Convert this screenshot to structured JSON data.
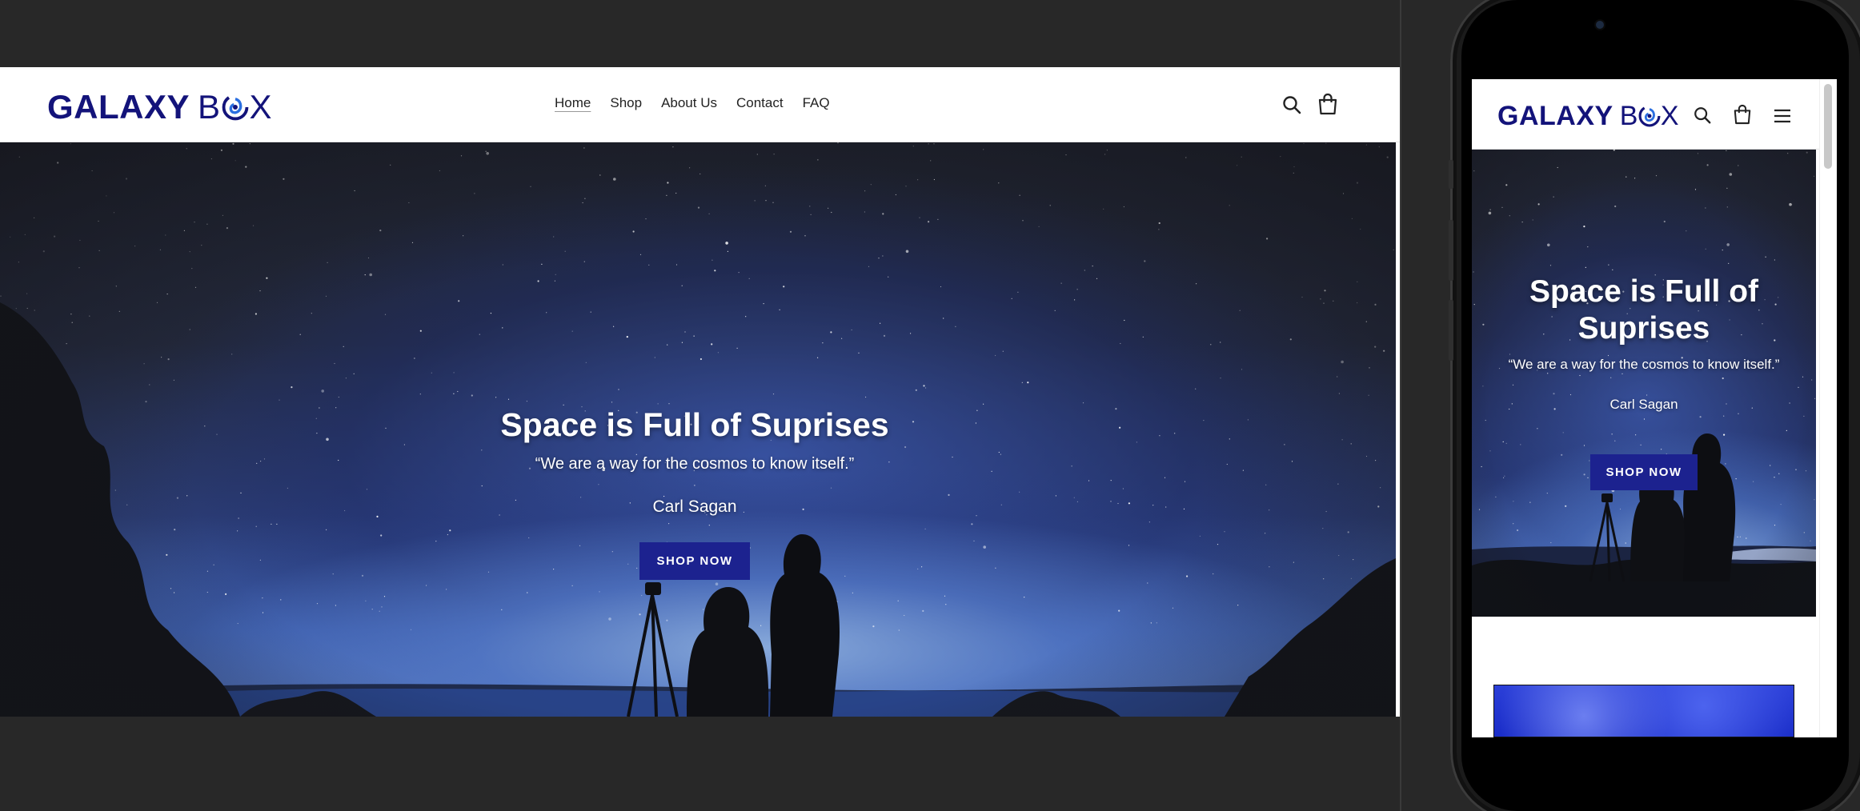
{
  "brand": {
    "name_part1": "GALAXY",
    "name_part2_prefix": "B",
    "name_part2_suffix": "X",
    "color": "#13137a"
  },
  "nav": {
    "items": [
      {
        "label": "Home",
        "active": true
      },
      {
        "label": "Shop",
        "active": false
      },
      {
        "label": "About Us",
        "active": false
      },
      {
        "label": "Contact",
        "active": false
      },
      {
        "label": "FAQ",
        "active": false
      }
    ]
  },
  "header_icons": [
    "search-icon",
    "cart-icon"
  ],
  "mobile_header_icons": [
    "search-icon",
    "cart-icon",
    "menu-icon"
  ],
  "hero": {
    "title": "Space is Full of Suprises",
    "quote": "“We are a way for the cosmos to know itself.”",
    "author": "Carl Sagan",
    "button_label": "SHOP NOW",
    "button_color": "#1c228f"
  },
  "mobile_hero": {
    "title_line1": "Space is Full of",
    "title_line2": "Suprises",
    "quote": "“We are a way for the cosmos to know itself.”",
    "author": "Carl Sagan",
    "button_label": "SHOP NOW"
  },
  "colors": {
    "background": "#282828",
    "header_bg": "#ffffff",
    "accent": "#1c228f"
  }
}
